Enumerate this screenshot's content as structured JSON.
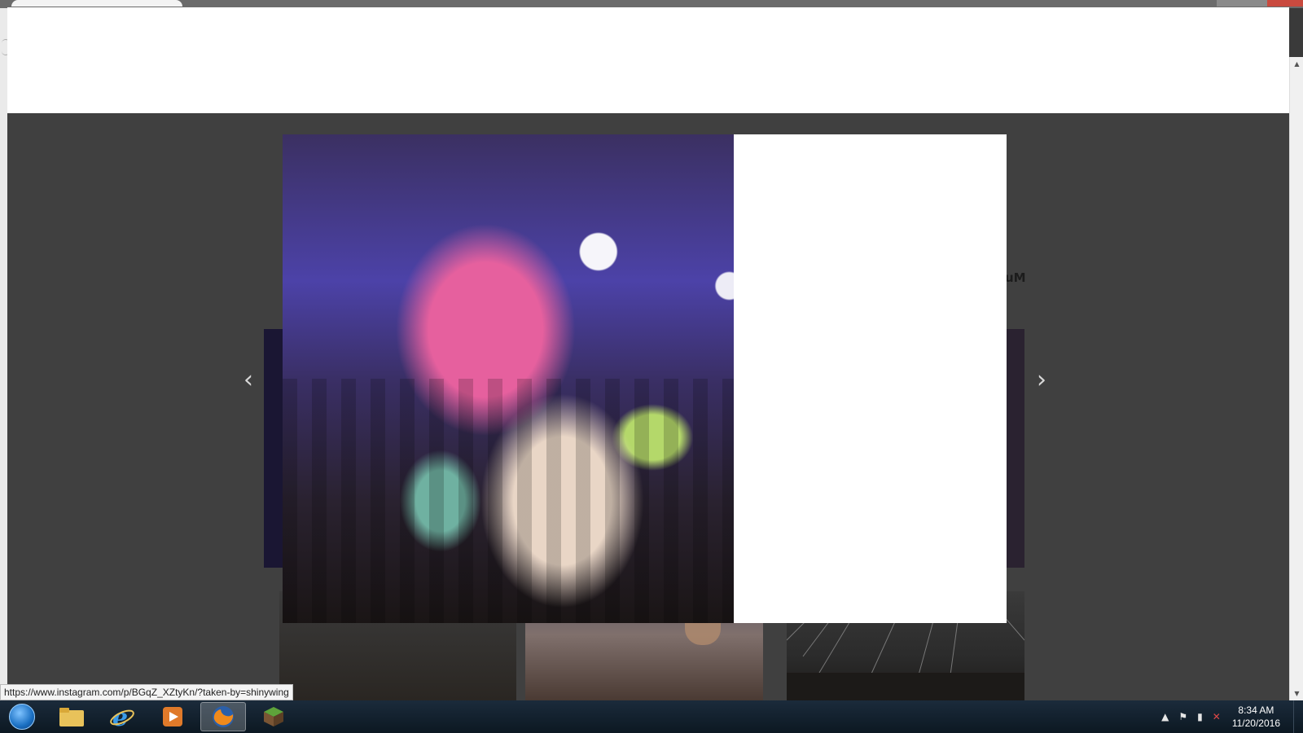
{
  "status_bar": {
    "url": "https://www.instagram.com/p/BGqZ_XZtyKn/?taken-by=shinywing"
  },
  "background": {
    "partial_label": "uM"
  },
  "modal": {
    "prev_icon": "‹",
    "next_icon": "›"
  },
  "scrollbar": {
    "up_icon": "▲",
    "down_icon": "▼"
  },
  "taskbar": {
    "apps": [
      {
        "name": "windows-explorer",
        "icon": "folder-icon"
      },
      {
        "name": "internet-explorer",
        "icon": "ie-icon"
      },
      {
        "name": "media-player",
        "icon": "media-player-icon"
      },
      {
        "name": "firefox",
        "icon": "firefox-icon",
        "active": true
      },
      {
        "name": "minecraft",
        "icon": "minecraft-icon"
      }
    ],
    "tray_icons": [
      "▲",
      "⚑",
      "▮",
      "✕"
    ],
    "clock_time": "8:34 AM",
    "clock_date": "11/20/2016"
  },
  "colors": {
    "overlay": "#404040",
    "taskbar": "#0c1822",
    "modal_bg": "#ffffff"
  }
}
